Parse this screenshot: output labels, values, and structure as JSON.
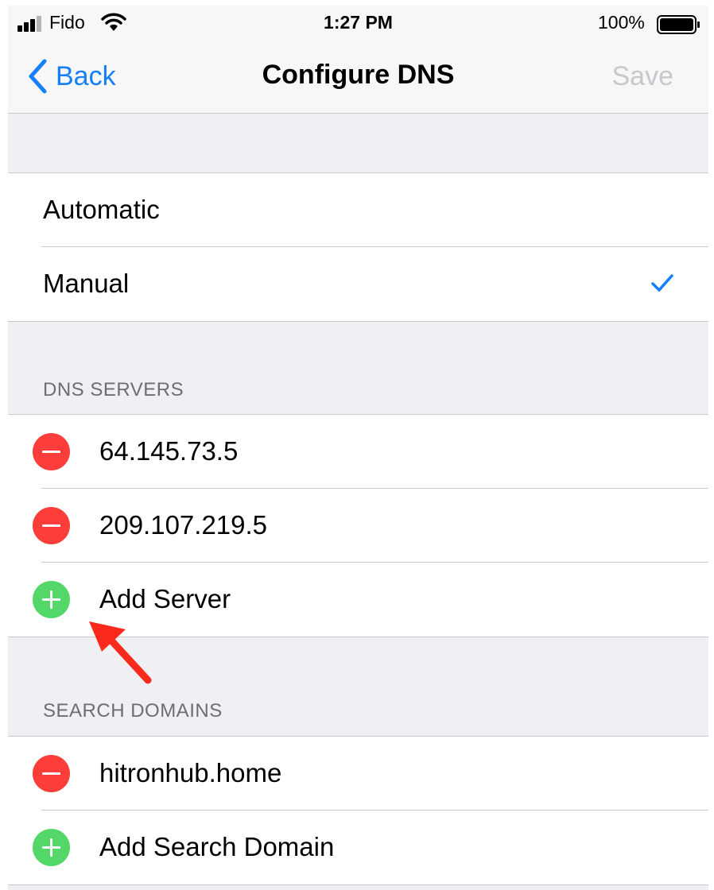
{
  "status_bar": {
    "carrier": "Fido",
    "time": "1:27 PM",
    "battery": "100%"
  },
  "nav": {
    "back_label": "Back",
    "title": "Configure DNS",
    "save_label": "Save"
  },
  "mode_options": [
    {
      "label": "Automatic",
      "selected": false
    },
    {
      "label": "Manual",
      "selected": true
    }
  ],
  "dns_servers": {
    "header": "DNS SERVERS",
    "items": [
      "64.145.73.5",
      "209.107.219.5"
    ],
    "add_label": "Add Server"
  },
  "search_domains": {
    "header": "SEARCH DOMAINS",
    "items": [
      "hitronhub.home"
    ],
    "add_label": "Add Search Domain"
  },
  "colors": {
    "accent": "#157efb",
    "delete": "#fc3d39",
    "add": "#53d769",
    "annotation_arrow": "#fb2a1d"
  }
}
